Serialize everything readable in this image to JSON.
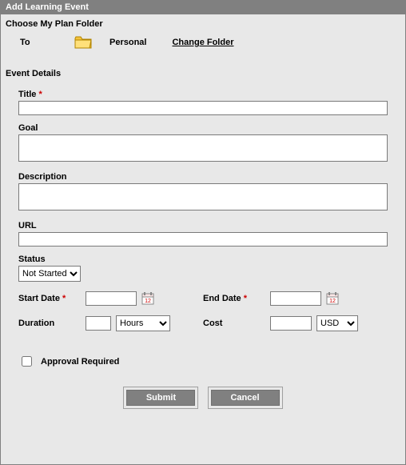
{
  "titlebar": "Add Learning Event",
  "folder": {
    "section": "Choose My Plan Folder",
    "to_label": "To",
    "current": "Personal",
    "change_label": "Change Folder"
  },
  "details": {
    "section": "Event Details",
    "title_label": "Title",
    "title_value": "",
    "goal_label": "Goal",
    "goal_value": "",
    "description_label": "Description",
    "description_value": "",
    "url_label": "URL",
    "url_value": "",
    "status_label": "Status",
    "status_value": "Not Started",
    "start_date_label": "Start Date",
    "start_date_value": "",
    "end_date_label": "End Date",
    "end_date_value": "",
    "duration_label": "Duration",
    "duration_value": "",
    "duration_unit": "Hours",
    "cost_label": "Cost",
    "cost_value": "",
    "cost_currency": "USD",
    "approval_label": "Approval Required",
    "approval_checked": false
  },
  "buttons": {
    "submit": "Submit",
    "cancel": "Cancel"
  }
}
